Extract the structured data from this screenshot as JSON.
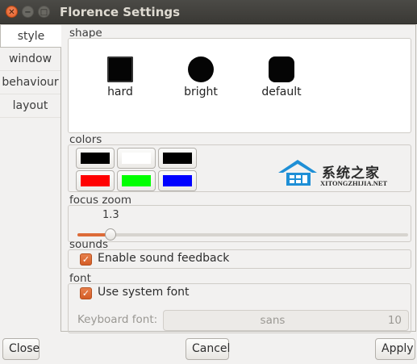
{
  "window": {
    "title": "Florence Settings"
  },
  "tabs": [
    {
      "label": "style",
      "active": true
    },
    {
      "label": "window",
      "active": false
    },
    {
      "label": "behaviour",
      "active": false
    },
    {
      "label": "layout",
      "active": false
    }
  ],
  "shape": {
    "label": "shape",
    "options": [
      {
        "name": "hard",
        "icon": "square-hard-icon"
      },
      {
        "name": "bright",
        "icon": "circle-bright-icon"
      },
      {
        "name": "default",
        "icon": "rounded-square-icon"
      }
    ]
  },
  "colors": {
    "label": "colors",
    "swatches": [
      "#000000",
      "#ffffff",
      "#000000",
      "#ff0000",
      "#00ff00",
      "#0000ff"
    ],
    "watermark": {
      "cn": "系统之家",
      "en": "XITONGZHIJIA.NET",
      "color": "#1e8fd6"
    }
  },
  "focus_zoom": {
    "label": "focus zoom",
    "value": "1.3",
    "slider_fraction": 0.1,
    "accent": "#dd6b38"
  },
  "sounds": {
    "label": "sounds",
    "enable_label": "Enable sound feedback",
    "checked": true
  },
  "font": {
    "label": "font",
    "system_label": "Use system font",
    "checked": true,
    "keyboard_label": "Keyboard font:",
    "font_name": "sans",
    "font_size": "10"
  },
  "buttons": {
    "close": "Close",
    "cancel": "Cancel",
    "apply": "Apply"
  }
}
